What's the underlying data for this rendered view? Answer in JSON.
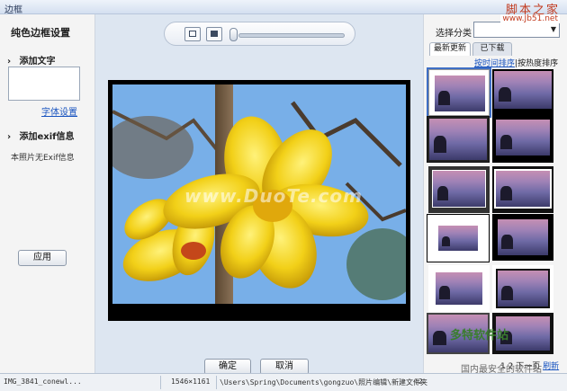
{
  "window": {
    "title": "边框",
    "brand": "脚本之家"
  },
  "brand_url": "www.Jb51.net",
  "left_panel": {
    "heading": "纯色边框设置",
    "add_text": "添加文字",
    "font_settings": "字体设置",
    "add_exif": "添加exif信息",
    "no_exif": "本照片无Exif信息",
    "apply": "应用"
  },
  "watermark": "www.DuoTe.com",
  "buttons": {
    "ok": "确定",
    "cancel": "取消"
  },
  "status": {
    "filename": "IMG_3841_conewl...",
    "size": "1546×1161",
    "path": "\\Users\\Spring\\Documents\\gongzuo\\照片编辑\\新建文件夹",
    "zoom": "(2"
  },
  "right_panel": {
    "category_label": "选择分类",
    "category_value": "",
    "tabs": [
      {
        "label": "最新更新"
      },
      {
        "label": "已下载"
      }
    ],
    "sort_by_time": "按时间排序",
    "sort_by_hot": "按热度排序",
    "pager": {
      "page1": "1",
      "page2": "2",
      "next": "下一页",
      "refresh": "刷新"
    }
  },
  "bottom_logo": {
    "line1": "多特软件站",
    "line2": "国内最安全的软件站"
  },
  "colors": {
    "accent": "#1a55c0",
    "selection": "#3f6fc4",
    "brand": "#c23a1e"
  }
}
